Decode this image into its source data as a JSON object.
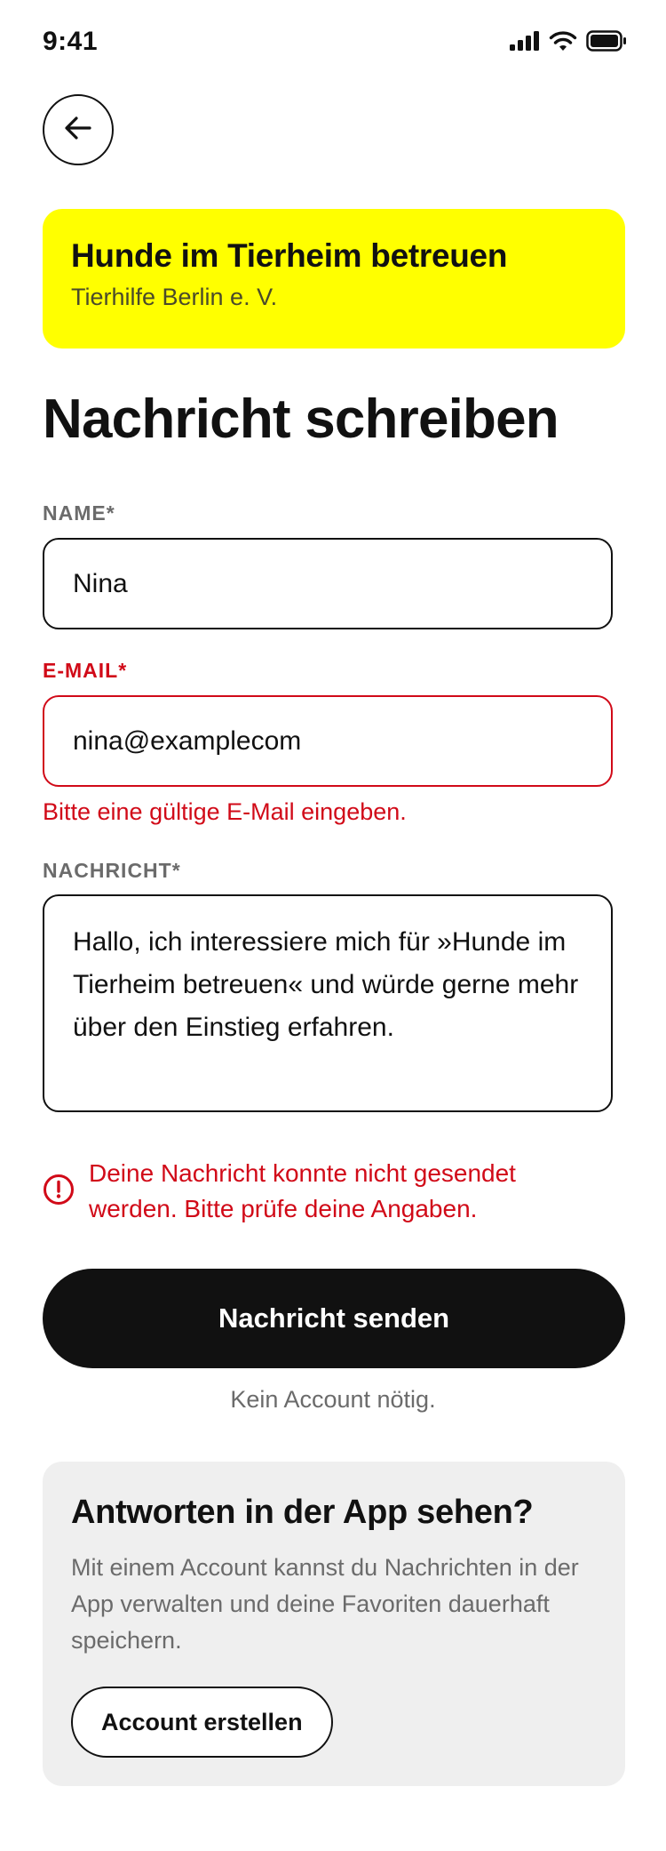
{
  "status_bar": {
    "time": "9:41",
    "icons": [
      "cellular-signal-icon",
      "wifi-icon",
      "battery-icon"
    ]
  },
  "header": {
    "back_icon": "arrow-left-icon"
  },
  "project_card": {
    "title": "Hunde im Tierheim betreuen",
    "organization": "Tierhilfe Berlin e. V.",
    "background_color": "#ffff00"
  },
  "page_title": "Nachricht schreiben",
  "form": {
    "name": {
      "label": "NAME*",
      "value": "Nina"
    },
    "email": {
      "label": "E-MAIL*",
      "value": "nina@examplecom",
      "error": "Bitte eine gültige E-Mail eingeben."
    },
    "message": {
      "label": "NACHRICHT*",
      "value": "Hallo, ich interessiere mich für »Hunde im Tierheim betreuen« und würde gerne mehr über den Einstieg erfahren."
    },
    "form_error": {
      "icon": "alert-circle-icon",
      "text": "Deine Nachricht konnte nicht gesendet werden. Bitte prüfe deine Angaben."
    },
    "submit_label": "Nachricht senden",
    "no_account_note": "Kein Account nötig."
  },
  "account_promo": {
    "title": "Antworten in der App sehen?",
    "description": "Mit einem Account kannst du Nachrichten in der App verwalten und deine Favoriten dauerhaft speichern.",
    "button_label": "Account erstellen"
  },
  "colors": {
    "accent_yellow": "#ffff00",
    "error_red": "#d10a18",
    "primary_black": "#111111",
    "muted_gray": "#6b6b6b",
    "card_gray": "#efefef"
  }
}
